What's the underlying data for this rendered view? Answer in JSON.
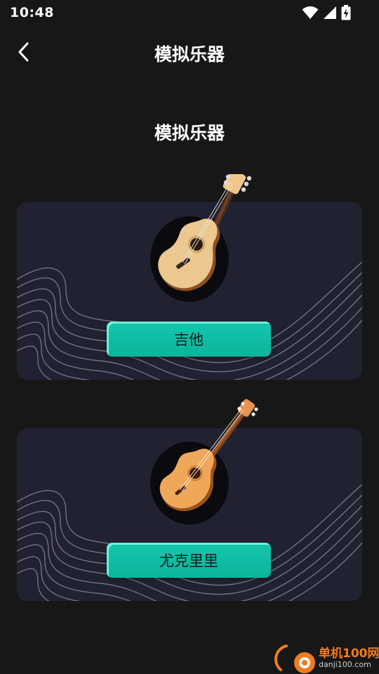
{
  "status_bar": {
    "time": "10:48",
    "icons": [
      "wifi-icon",
      "cellular-signal-icon",
      "battery-charging-icon"
    ]
  },
  "app_bar": {
    "title": "模拟乐器",
    "back_icon": "chevron-left-icon"
  },
  "section": {
    "title": "模拟乐器"
  },
  "instruments": [
    {
      "name": "guitar",
      "button_label": "吉他",
      "icon": "acoustic-guitar-icon"
    },
    {
      "name": "ukulele",
      "button_label": "尤克里里",
      "icon": "ukulele-icon"
    }
  ],
  "watermark": {
    "title": "单机100网",
    "url": "danji100.com"
  },
  "colors": {
    "background": "#171717",
    "card": "#202231",
    "button": "#12c3a9",
    "button_text": "#1a1a1a",
    "watermark_accent": "#f07b1e"
  }
}
